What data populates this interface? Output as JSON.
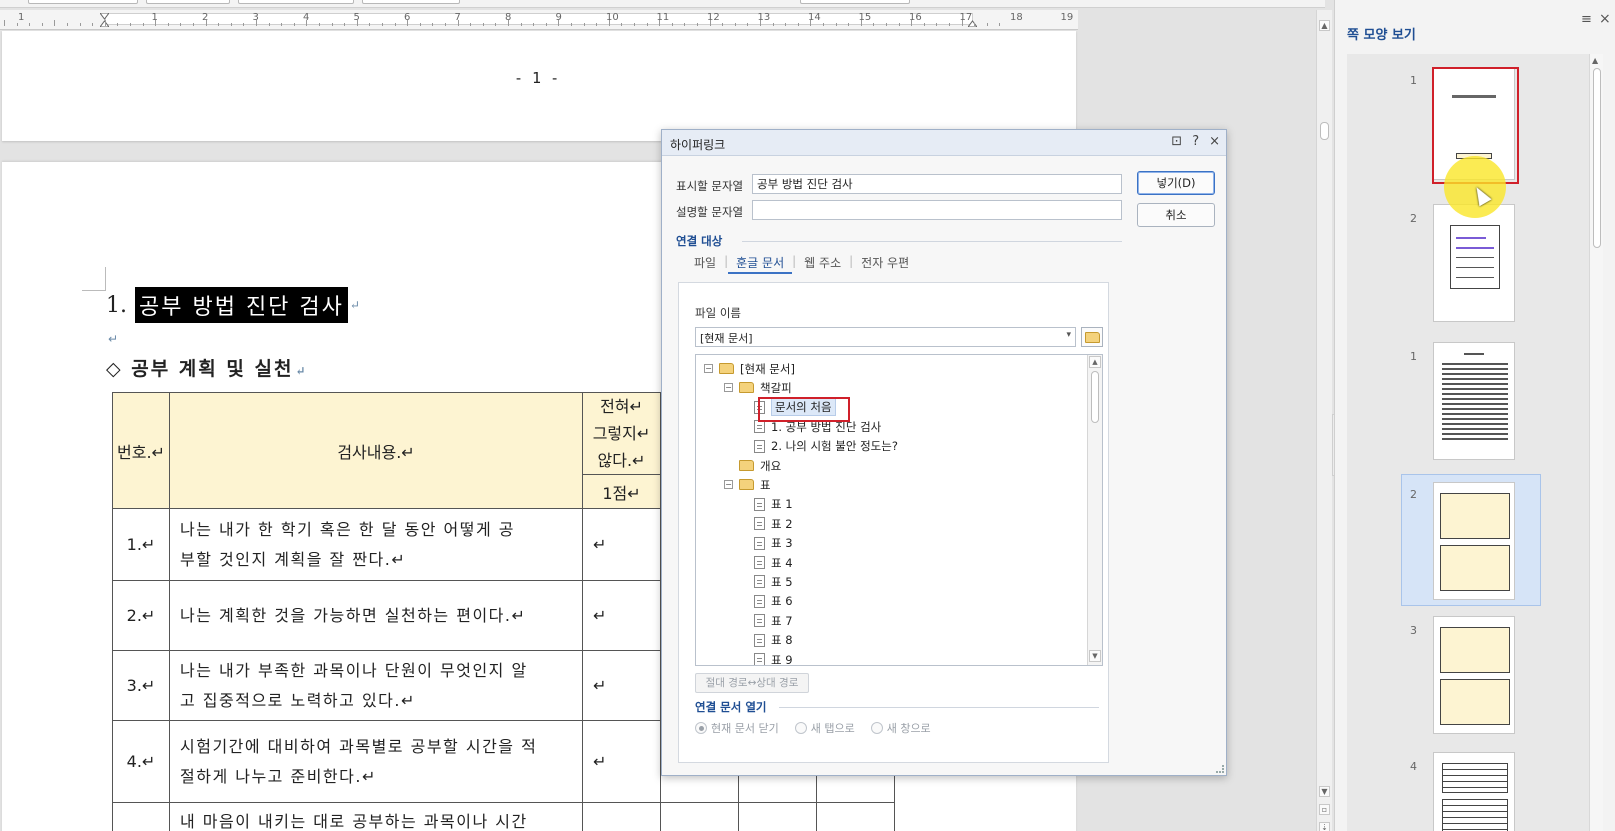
{
  "document": {
    "page_number": "- 1 -",
    "heading1": {
      "number": "1.",
      "text": "공부 방법 진단 검사"
    },
    "heading2": "◇ 공부 계획 및 실천",
    "para_mark": "↵",
    "table": {
      "header": {
        "no": "번호.↵",
        "content": "검사내용.↵",
        "col1_l1": "전혀↵",
        "col1_l2": "그렇지↵",
        "col1_l3": "않다.↵",
        "col1_score": "1점↵"
      },
      "rows": [
        {
          "no": "1.↵",
          "l1": "나는 내가 한 학기 혹은 한 달 동안 어떻게 공",
          "l2": "부할 것인지 계획을 잘 짠다.↵",
          "v": "↵"
        },
        {
          "no": "2.↵",
          "l1": "나는 계획한 것을 가능하면 실천하는 편이다.↵",
          "l2": "",
          "v": "↵"
        },
        {
          "no": "3.↵",
          "l1": "나는 내가 부족한 과목이나 단원이 무엇인지 알",
          "l2": "고 집중적으로 노력하고 있다.↵",
          "v": "↵"
        },
        {
          "no": "4.↵",
          "l1": "시험기간에 대비하여 과목별로 공부할 시간을 적",
          "l2": "절하게 나누고 준비한다.↵",
          "v": "↵"
        },
        {
          "no": "",
          "l1": "내 마음이 내키는 대로 공부하는 과목이나 시간",
          "l2": "",
          "v": ""
        }
      ]
    }
  },
  "ruler": {
    "numbers": [
      "1",
      "1",
      "2",
      "3",
      "4",
      "5",
      "6",
      "7",
      "8",
      "9",
      "10",
      "11",
      "12",
      "13",
      "14",
      "15",
      "16",
      "17",
      "18",
      "19"
    ]
  },
  "dialog": {
    "title": "하이퍼링크",
    "display_text_label": "표시할 문자열",
    "display_text_value": "공부 방법 진단 검사",
    "description_label": "설명할 문자열",
    "description_value": "",
    "insert_button": "넣기(D)",
    "cancel_button": "취소",
    "link_target_label": "연결 대상",
    "tabs": [
      "파일",
      "훈글 문서",
      "웹 주소",
      "전자 우편"
    ],
    "file_name_label": "파일 이름",
    "file_combo_value": "[현재 문서]",
    "tree": [
      {
        "label": "[현재 문서]",
        "type": "folder-open",
        "toggle": "−"
      },
      {
        "label": "책갈피",
        "type": "folder-open",
        "toggle": "−"
      },
      {
        "label": "문서의 처음",
        "type": "doc"
      },
      {
        "label": "1. 공부 방법 진단 검사",
        "type": "doc"
      },
      {
        "label": "2. 나의 시험 불안 정도는?",
        "type": "doc"
      },
      {
        "label": "개요",
        "type": "folder"
      },
      {
        "label": "표",
        "type": "folder-open",
        "toggle": "−"
      },
      {
        "label": "표 1",
        "type": "doc"
      },
      {
        "label": "표 2",
        "type": "doc"
      },
      {
        "label": "표 3",
        "type": "doc"
      },
      {
        "label": "표 4",
        "type": "doc"
      },
      {
        "label": "표 5",
        "type": "doc"
      },
      {
        "label": "표 6",
        "type": "doc"
      },
      {
        "label": "표 7",
        "type": "doc"
      },
      {
        "label": "표 8",
        "type": "doc"
      },
      {
        "label": "표 9",
        "type": "doc"
      }
    ],
    "path_button": "절대 경로↔상대 경로",
    "open_section_label": "연결 문서 열기",
    "radio_options": [
      "현재 문서 닫기",
      "새 탭으로",
      "새 창으로"
    ],
    "radio_selected": "현재 문서 닫기"
  },
  "thumb_panel": {
    "title": "쪽 모양 보기",
    "pages": [
      "1",
      "2",
      "1",
      "2",
      "3",
      "4"
    ]
  },
  "colors": {
    "accent": "#1f4e93",
    "highlight_red": "#d0202a",
    "table_header": "#fdf4d2"
  }
}
